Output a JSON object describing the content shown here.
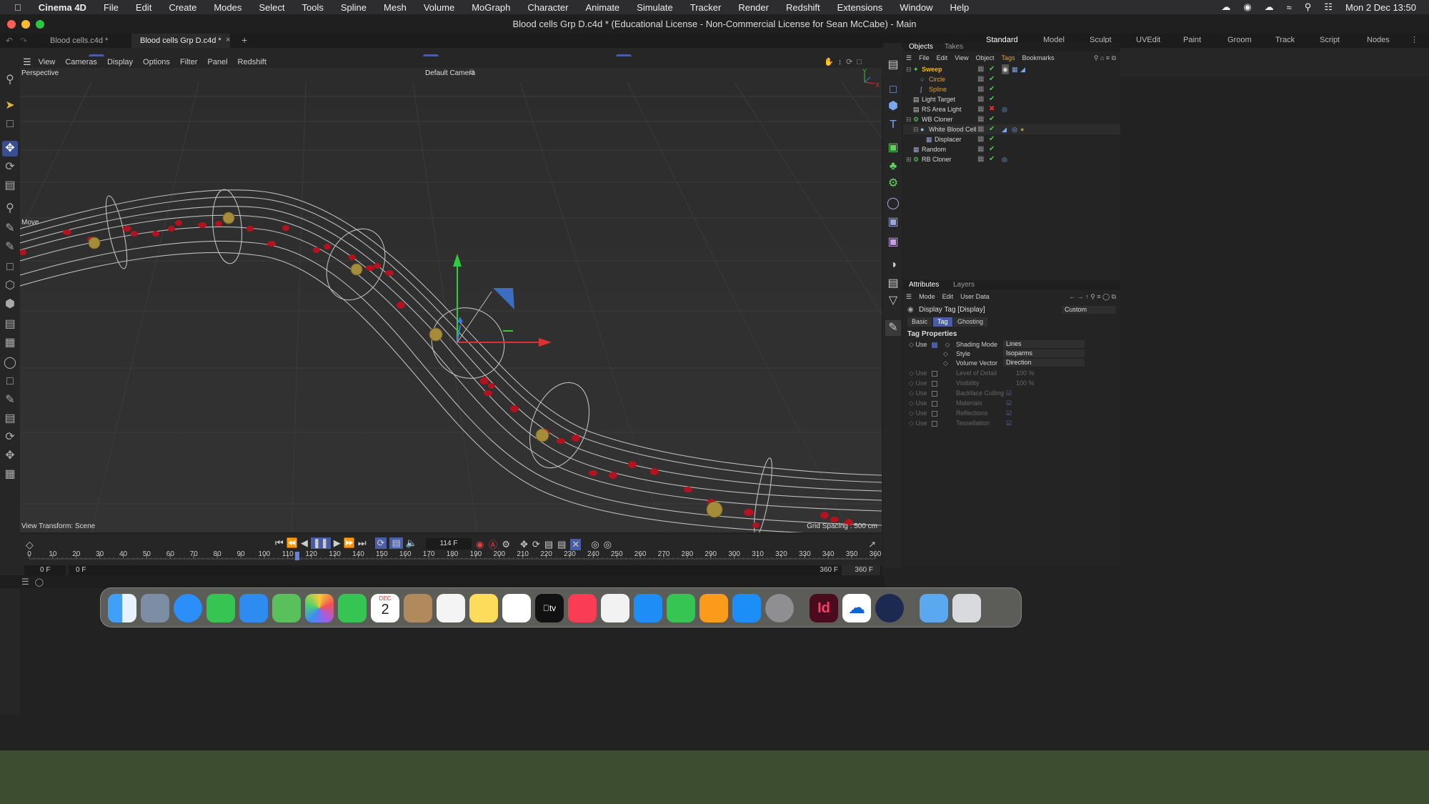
{
  "mac_menu": {
    "app": "Cinema 4D",
    "items": [
      "File",
      "Edit",
      "Create",
      "Modes",
      "Select",
      "Tools",
      "Spline",
      "Mesh",
      "Volume",
      "MoGraph",
      "Character",
      "Animate",
      "Simulate",
      "Tracker",
      "Render",
      "Redshift",
      "Extensions",
      "Window",
      "Help"
    ],
    "clock": "Mon 2 Dec  13:50"
  },
  "window": {
    "title": "Blood cells Grp D.c4d * (Educational License - Non-Commercial License for Sean McCabe) - Main"
  },
  "doc_tabs": [
    "Blood cells.c4d *",
    "Blood cells Grp D.c4d *"
  ],
  "layouts": [
    "Standard",
    "Model",
    "Sculpt",
    "UVEdit",
    "Paint",
    "Groom",
    "Track",
    "Script",
    "Nodes"
  ],
  "axis_buttons": [
    "X",
    "Y",
    "Z"
  ],
  "viewport": {
    "menu": [
      "View",
      "Cameras",
      "Display",
      "Options",
      "Filter",
      "Panel",
      "Redshift"
    ],
    "name": "Perspective",
    "camera": "Default Camera",
    "tool_label": "Move",
    "view_transform": "View Transform: Scene",
    "grid_spacing": "Grid Spacing : 500 cm",
    "axis_y": "Y",
    "axis_x": "X"
  },
  "timeline": {
    "current_frame": "114 F",
    "ticks": [
      "0",
      "10",
      "20",
      "30",
      "40",
      "50",
      "60",
      "70",
      "80",
      "90",
      "100",
      "110",
      "120",
      "130",
      "140",
      "150",
      "160",
      "170",
      "180",
      "190",
      "200",
      "210",
      "220",
      "230",
      "240",
      "250",
      "260",
      "270",
      "280",
      "290",
      "300",
      "310",
      "320",
      "330",
      "340",
      "350",
      "360"
    ],
    "start": "0 F",
    "start2": "0 F",
    "end": "360 F",
    "end2": "360 F",
    "playhead": 114,
    "max": 360
  },
  "objects_panel": {
    "tabs": [
      "Objects",
      "Takes"
    ],
    "menu": [
      "File",
      "Edit",
      "View",
      "Object",
      "Tags",
      "Bookmarks"
    ],
    "items": [
      {
        "name": "Sweep",
        "indent": 0,
        "color": "#f4b400"
      },
      {
        "name": "Circle",
        "indent": 1,
        "color": "#e8a21b"
      },
      {
        "name": "Spline",
        "indent": 1,
        "color": "#e8a21b"
      },
      {
        "name": "Light Target",
        "indent": 0,
        "color": "#d8d8d8"
      },
      {
        "name": "RS Area Light",
        "indent": 0,
        "color": "#d8d8d8"
      },
      {
        "name": "WB Cloner",
        "indent": 0,
        "color": "#d8d8d8"
      },
      {
        "name": "White Blood Cell",
        "indent": 1,
        "color": "#d8d8d8"
      },
      {
        "name": "Displacer",
        "indent": 2,
        "color": "#d8d8d8"
      },
      {
        "name": "Random",
        "indent": 0,
        "color": "#d8d8d8"
      },
      {
        "name": "RB Cloner",
        "indent": 0,
        "color": "#d8d8d8"
      }
    ]
  },
  "attributes_panel": {
    "tabs": [
      "Attributes",
      "Layers"
    ],
    "menu": [
      "Mode",
      "Edit",
      "User Data"
    ],
    "header": "Display Tag [Display]",
    "preset": "Custom",
    "subtabs": [
      "Basic",
      "Tag",
      "Ghosting"
    ],
    "section": "Tag Properties",
    "props": [
      {
        "use": "Use",
        "label": "Shading Mode",
        "value": "Lines",
        "enabled": true
      },
      {
        "use": "",
        "label": "Style",
        "value": "Isoparms",
        "enabled": true
      },
      {
        "use": "",
        "label": "Volume Vector",
        "value": "Direction",
        "enabled": true
      },
      {
        "use": "Use",
        "label": "Level of Detail",
        "value": "100 %",
        "enabled": false
      },
      {
        "use": "Use",
        "label": "Visibility",
        "value": "100 %",
        "enabled": false
      },
      {
        "use": "Use",
        "label": "Backface Culling",
        "value": "",
        "enabled": false
      },
      {
        "use": "Use",
        "label": "Materials",
        "value": "",
        "enabled": false
      },
      {
        "use": "Use",
        "label": "Reflections",
        "value": "",
        "enabled": false
      },
      {
        "use": "Use",
        "label": "Tessellation",
        "value": "",
        "enabled": false
      }
    ]
  },
  "dock": {
    "date_month": "DEC",
    "date_day": "2",
    "id_label": "Id"
  }
}
